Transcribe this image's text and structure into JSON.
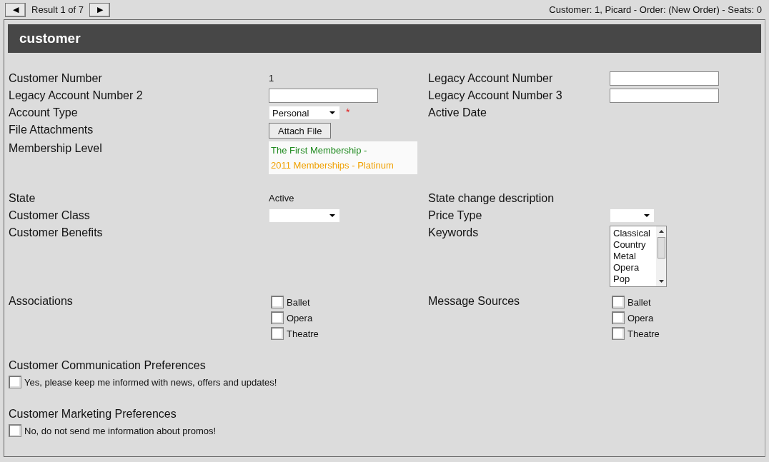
{
  "nav": {
    "prev": "◀",
    "result": "Result 1 of 7",
    "next": "▶",
    "status": "Customer: 1, Picard - Order: (New Order) - Seats: 0"
  },
  "panel": {
    "title": "customer"
  },
  "rows": [
    {
      "left": {
        "label": "Customer Number",
        "kind": "text",
        "value": "1"
      },
      "right": {
        "label": "Legacy Account Number",
        "kind": "input"
      }
    },
    {
      "left": {
        "label": "Legacy Account Number 2",
        "kind": "input"
      },
      "right": {
        "label": "Legacy Account Number 3",
        "kind": "input"
      }
    },
    {
      "left": {
        "label": "Account Type",
        "kind": "select",
        "value": "Personal",
        "required_mark": "*"
      },
      "right": {
        "label": "Active Date"
      }
    },
    {
      "left": {
        "label": "File Attachments",
        "kind": "button",
        "button": "Attach File"
      }
    },
    {
      "left": {
        "label": "Membership Level",
        "kind": "membership",
        "lines": [
          {
            "text": "The First Membership -",
            "color": "#1f8a1f"
          },
          {
            "text": "2011 Memberships - Platinum",
            "color": "#f0a000"
          }
        ]
      }
    },
    {
      "left": {
        "label": "State",
        "kind": "text",
        "value": "Active"
      },
      "right": {
        "label": "State change description"
      }
    },
    {
      "left": {
        "label": "Customer Class",
        "kind": "select"
      },
      "right": {
        "label": "Price Type",
        "kind": "select"
      }
    },
    {
      "left": {
        "label": "Customer Benefits"
      },
      "right": {
        "label": "Keywords",
        "kind": "listbox",
        "options": [
          "Classical",
          "Country",
          "Metal",
          "Opera",
          "Pop"
        ]
      }
    },
    {
      "left": {
        "label": "Associations",
        "kind": "checks",
        "options": [
          {
            "label": "Ballet",
            "checked": false
          },
          {
            "label": "Opera",
            "checked": false
          },
          {
            "label": "Theatre",
            "checked": false
          }
        ]
      },
      "right": {
        "label": "Message Sources",
        "kind": "checks",
        "options": [
          {
            "label": "Ballet",
            "checked": false
          },
          {
            "label": "Opera",
            "checked": false
          },
          {
            "label": "Theatre",
            "checked": false
          }
        ]
      }
    }
  ],
  "preferences": [
    {
      "title": "Customer Communication Preferences",
      "option": {
        "label": "Yes, please keep me informed with news, offers and updates!",
        "checked": false
      }
    },
    {
      "title": "Customer Marketing Preferences",
      "option": {
        "label": "No, do not send me information about promos!",
        "checked": false
      }
    }
  ]
}
